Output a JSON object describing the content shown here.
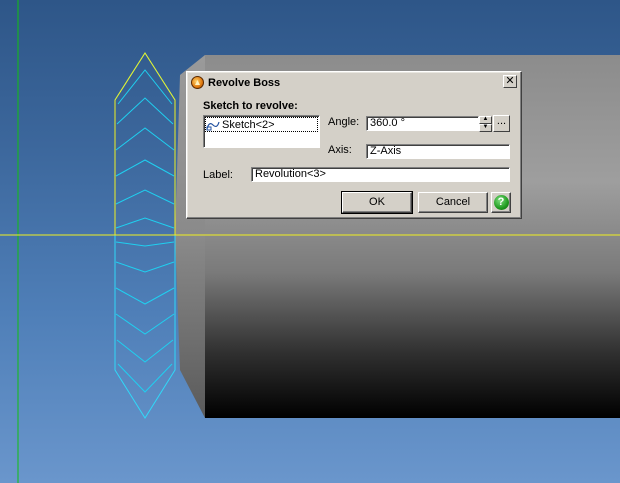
{
  "dialog": {
    "title": "Revolve Boss",
    "close_glyph": "✕",
    "sketch_heading": "Sketch to revolve:",
    "sketch_items": [
      {
        "label": "Sketch<2>",
        "icon": "sketch-icon"
      }
    ],
    "angle_label": "Angle:",
    "angle_value": "360.0 °",
    "angle_browse_label": "...",
    "axis_label": "Axis:",
    "axis_value": "Z-Axis",
    "label_label": "Label:",
    "label_value": "Revolution<3>",
    "ok_label": "OK",
    "cancel_label": "Cancel",
    "help_glyph": "?"
  },
  "colors": {
    "viewport_top": "#2e5688",
    "viewport_bottom": "#6a96cc",
    "wireframe": "#1fd0f0",
    "highlight": "#f0f020",
    "axis_line": "#10c010",
    "dialog_bg": "#d4d0c8"
  }
}
